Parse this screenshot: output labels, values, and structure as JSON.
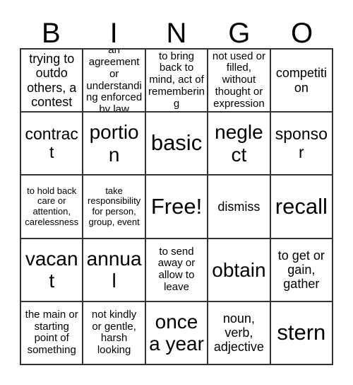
{
  "card": {
    "header_letters": [
      "B",
      "I",
      "N",
      "G",
      "O"
    ],
    "rows": [
      [
        {
          "text": "trying to outdo others, a contest",
          "size": "md"
        },
        {
          "text": "an agreement or understanding enforced by law",
          "size": "sm"
        },
        {
          "text": "to bring back to mind, act of remembering",
          "size": "sm"
        },
        {
          "text": "not used or filled, without thought or expression",
          "size": "sm"
        },
        {
          "text": "competition",
          "size": "md"
        }
      ],
      [
        {
          "text": "contract",
          "size": "lg"
        },
        {
          "text": "portion",
          "size": "xl"
        },
        {
          "text": "basic",
          "size": "xxl"
        },
        {
          "text": "neglect",
          "size": "xl"
        },
        {
          "text": "sponsor",
          "size": "lg"
        }
      ],
      [
        {
          "text": "to hold back care or attention, carelessness",
          "size": "xs"
        },
        {
          "text": "take responsibility for person, group, event",
          "size": "xs"
        },
        {
          "text": "Free!",
          "size": "xxl"
        },
        {
          "text": "dismiss",
          "size": "md"
        },
        {
          "text": "recall",
          "size": "xxl"
        }
      ],
      [
        {
          "text": "vacant",
          "size": "xl"
        },
        {
          "text": "annual",
          "size": "xl"
        },
        {
          "text": "to send away or allow to leave",
          "size": "sm"
        },
        {
          "text": "obtain",
          "size": "xl"
        },
        {
          "text": "to get or gain, gather",
          "size": "md"
        }
      ],
      [
        {
          "text": "the main or starting point of something",
          "size": "sm"
        },
        {
          "text": "not kindly or gentle, harsh looking",
          "size": "sm"
        },
        {
          "text": "once\na year",
          "size": "xl"
        },
        {
          "text": "noun, verb, adjective",
          "size": "md"
        },
        {
          "text": "stern",
          "size": "xxl"
        }
      ]
    ]
  },
  "colors": {
    "background": "#ffffff",
    "text": "#000000",
    "grid_line": "#333333"
  }
}
